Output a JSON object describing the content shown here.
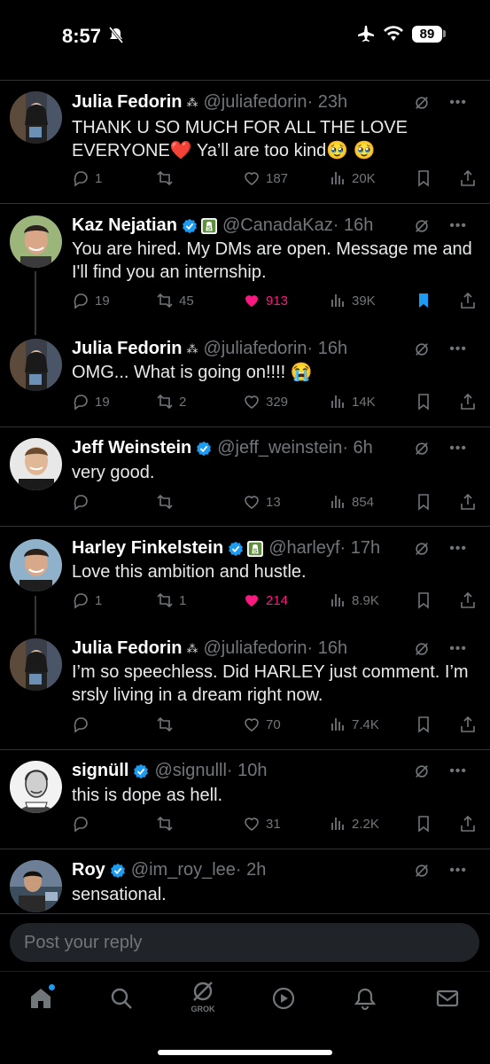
{
  "status_bar": {
    "time": "8:57",
    "battery": "89"
  },
  "tweets": [
    {
      "name": "Julia Fedorin",
      "handle": "@juliafedorin",
      "time": "· 23h",
      "text": "THANK U SO MUCH FOR ALL THE LOVE EVERYONE❤️  Ya’ll are too kind🥹 🥹",
      "replies": "1",
      "retweets": "",
      "likes": "187",
      "views": "20K"
    },
    {
      "name": "Kaz Nejatian",
      "handle": "@CanadaKaz",
      "time": "· 16h",
      "text": "You are hired.   My DMs are open.  Message me and I'll find you an internship.",
      "replies": "19",
      "retweets": "45",
      "likes": "913",
      "views": "39K"
    },
    {
      "name": "Julia Fedorin",
      "handle": "@juliafedorin",
      "time": "· 16h",
      "text": "OMG... What is going on!!!! 😭",
      "replies": "19",
      "retweets": "2",
      "likes": "329",
      "views": "14K"
    },
    {
      "name": "Jeff Weinstein",
      "handle": "@jeff_weinstein",
      "time": "· 6h",
      "text": "very good.",
      "replies": "",
      "retweets": "",
      "likes": "13",
      "views": "854"
    },
    {
      "name": "Harley Finkelstein",
      "handle": "@harleyf",
      "time": "· 17h",
      "text": "Love this ambition and hustle.",
      "replies": "1",
      "retweets": "1",
      "likes": "214",
      "views": "8.9K"
    },
    {
      "name": "Julia Fedorin",
      "handle": "@juliafedorin",
      "time": "· 16h",
      "text": "I’m so speechless. Did HARLEY just comment. I’m srsly living in a dream right now.",
      "replies": "",
      "retweets": "",
      "likes": "70",
      "views": "7.4K"
    },
    {
      "name": "signüll",
      "handle": "@signulll",
      "time": "· 10h",
      "text": "this is dope as hell.",
      "replies": "",
      "retweets": "",
      "likes": "31",
      "views": "2.2K"
    },
    {
      "name": "Roy",
      "handle": "@im_roy_lee",
      "time": "· 2h",
      "text": "sensational."
    }
  ],
  "reply_bar": {
    "placeholder": "Post your reply"
  },
  "tab_bar": {
    "grok_label": "GROK"
  },
  "colors": {
    "background": "#000000",
    "accent": "#1d9bf0",
    "like": "#f91880",
    "muted": "#71767b"
  },
  "icons": [
    "home-icon",
    "search-icon",
    "grok-icon",
    "video-icon",
    "bell-icon",
    "mail-icon"
  ]
}
